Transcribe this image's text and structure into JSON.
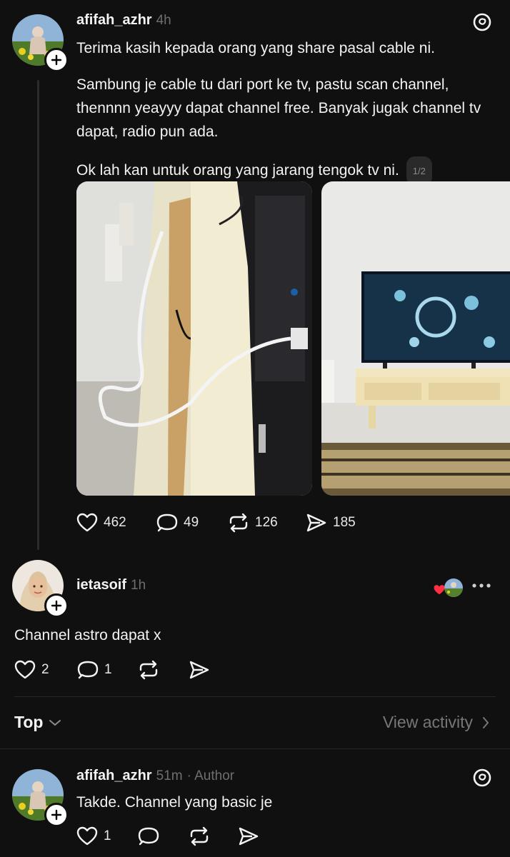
{
  "post": {
    "username": "afifah_azhr",
    "time": "4h",
    "paragraphs": [
      "Terima kasih kepada orang yang share pasal cable ni.",
      "Sambung je cable tu dari port ke tv, pastu scan channel, thennnn yeayyy dapat channel free. Banyak jugak channel tv dapat, radio pun ada.",
      "Ok lah kan untuk orang yang jarang tengok tv ni."
    ],
    "image_counter": "1/2",
    "likes": "462",
    "replies": "49",
    "reposts": "126",
    "shares": "185"
  },
  "reply1": {
    "username": "ietasoif",
    "time": "1h",
    "text": "Channel astro dapat x",
    "likes": "2",
    "replies": "1"
  },
  "sort": {
    "label": "Top",
    "view_activity": "View activity"
  },
  "reply2": {
    "username": "afifah_azhr",
    "time": "51m",
    "author_tag": "· Author",
    "text": "Takde. Channel yang basic je",
    "likes": "1"
  }
}
